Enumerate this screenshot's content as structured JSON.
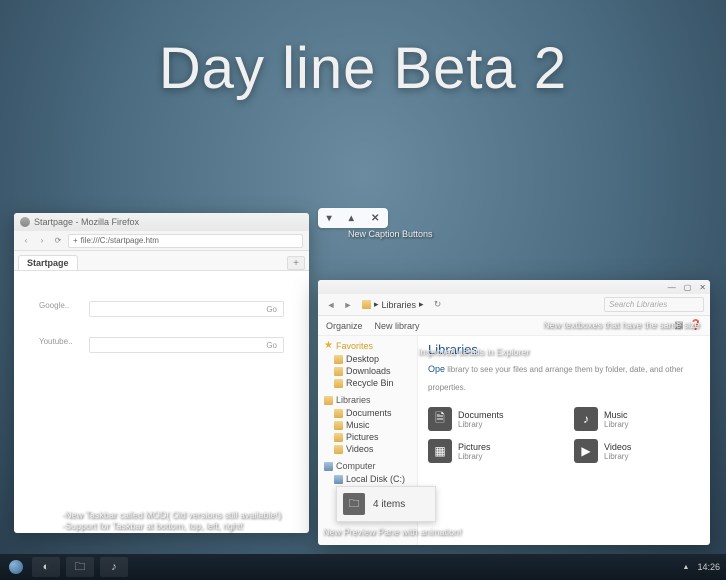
{
  "title": "Day line Beta 2",
  "firefox": {
    "title": "Startpage - Mozilla Firefox",
    "url": "file:///C:/startpage.htm",
    "tab": "Startpage",
    "search1_label": "Google..",
    "search2_label": "Youtube..",
    "go": "Go"
  },
  "caption": {
    "min": "▾",
    "max": "▴",
    "close": "✕"
  },
  "explorer": {
    "crumb_root": "Libraries",
    "search_placeholder": "Search Libraries",
    "organize": "Organize",
    "newlib": "New library",
    "heading": "Libraries",
    "open": "Ope",
    "desc": " library to see your files and arrange them by folder, date, and other properties.",
    "sidebar": {
      "fav": "Favorites",
      "fav_items": [
        "Desktop",
        "Downloads",
        "Recycle Bin"
      ],
      "lib": "Libraries",
      "lib_items": [
        "Documents",
        "Music",
        "Pictures",
        "Videos"
      ],
      "comp": "Computer",
      "comp_items": [
        "Local Disk (C:)"
      ]
    },
    "libs": [
      {
        "name": "Documents",
        "sub": "Library",
        "icon": "🗎"
      },
      {
        "name": "Music",
        "sub": "Library",
        "icon": "♪"
      },
      {
        "name": "Pictures",
        "sub": "Library",
        "icon": "▦"
      },
      {
        "name": "Videos",
        "sub": "Library",
        "icon": "▶"
      }
    ]
  },
  "preview": {
    "count": "4 items"
  },
  "annotations": {
    "caption": "New Caption Buttons",
    "textboxes": "New textboxes that have the same size",
    "details": "Improved details in Explorer",
    "taskbar1": "-New Taskbar called MOD( Old versions still available!)",
    "taskbar2": "-Support for Taskbar at bottom, top, left, right!",
    "preview": "New Preview Pane with animation!"
  },
  "clock": "14:26"
}
